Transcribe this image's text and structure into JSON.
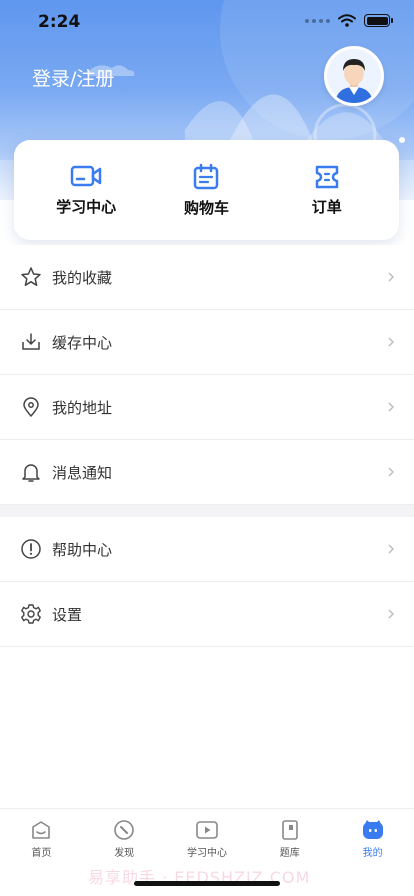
{
  "status_bar": {
    "time": "2:24"
  },
  "header": {
    "login_text": "登录/注册"
  },
  "quick_actions": [
    {
      "label": "学习中心",
      "icon": "video-camera-icon"
    },
    {
      "label": "购物车",
      "icon": "calendar-cart-icon"
    },
    {
      "label": "订单",
      "icon": "ticket-icon"
    }
  ],
  "menu_group_1": [
    {
      "label": "我的收藏",
      "icon": "star-icon"
    },
    {
      "label": "缓存中心",
      "icon": "download-icon"
    },
    {
      "label": "我的地址",
      "icon": "location-pin-icon"
    },
    {
      "label": "消息通知",
      "icon": "bell-icon"
    }
  ],
  "menu_group_2": [
    {
      "label": "帮助中心",
      "icon": "info-circle-icon"
    },
    {
      "label": "设置",
      "icon": "gear-icon"
    }
  ],
  "tabbar": [
    {
      "label": "首页",
      "icon": "home-icon",
      "active": false
    },
    {
      "label": "发现",
      "icon": "compass-icon",
      "active": false
    },
    {
      "label": "学习中心",
      "icon": "play-icon",
      "active": false
    },
    {
      "label": "题库",
      "icon": "book-icon",
      "active": false
    },
    {
      "label": "我的",
      "icon": "profile-face-icon",
      "active": true
    }
  ],
  "watermark": "易享助手 · EEDSHZIZ.COM",
  "colors": {
    "accent": "#3a7cf0",
    "header_top": "#5f97ee"
  }
}
